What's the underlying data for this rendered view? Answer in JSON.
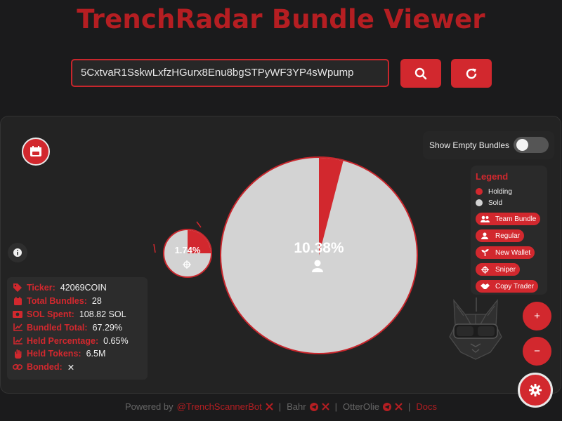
{
  "header": {
    "title": "TrenchRadar Bundle Viewer"
  },
  "search": {
    "value": "5CxtvaR1SskwLxfzHGurx8Enu8bgSTPyWF3YP4sWpump"
  },
  "controls": {
    "show_empty_label": "Show Empty Bundles",
    "show_empty_on": false
  },
  "legend": {
    "title": "Legend",
    "holding": "Holding",
    "sold": "Sold",
    "types": [
      {
        "label": "Team Bundle",
        "icon": "users-icon"
      },
      {
        "label": "Regular",
        "icon": "user-icon"
      },
      {
        "label": "New Wallet",
        "icon": "seedling-icon"
      },
      {
        "label": "Sniper",
        "icon": "crosshairs-icon"
      },
      {
        "label": "Copy Trader",
        "icon": "handshake-icon"
      }
    ]
  },
  "colors": {
    "holding": "#d2282e",
    "sold": "#d3d3d3",
    "accent": "#b51e22"
  },
  "bubbles": [
    {
      "percent_label": "10.38%",
      "holding_fraction": 0.04,
      "type": "user-icon"
    },
    {
      "percent_label": "1.74%",
      "holding_fraction": 0.25,
      "type": "crosshairs-icon"
    }
  ],
  "stats": {
    "ticker_label": "Ticker:",
    "ticker": "42069COIN",
    "total_bundles_label": "Total Bundles:",
    "total_bundles": "28",
    "sol_spent_label": "SOL Spent:",
    "sol_spent": "108.82 SOL",
    "bundled_total_label": "Bundled Total:",
    "bundled_total": "67.29%",
    "held_percentage_label": "Held Percentage:",
    "held_percentage": "0.65%",
    "held_tokens_label": "Held Tokens:",
    "held_tokens": "6.5M",
    "bonded_label": "Bonded:",
    "bonded": "✕"
  },
  "zoom": {
    "in": "+",
    "out": "−"
  },
  "footer": {
    "powered_by": "Powered by",
    "link1": "@TrenchScannerBot",
    "name2": "Bahr",
    "name3": "OtterOlie",
    "docs": "Docs",
    "sep": "|"
  }
}
